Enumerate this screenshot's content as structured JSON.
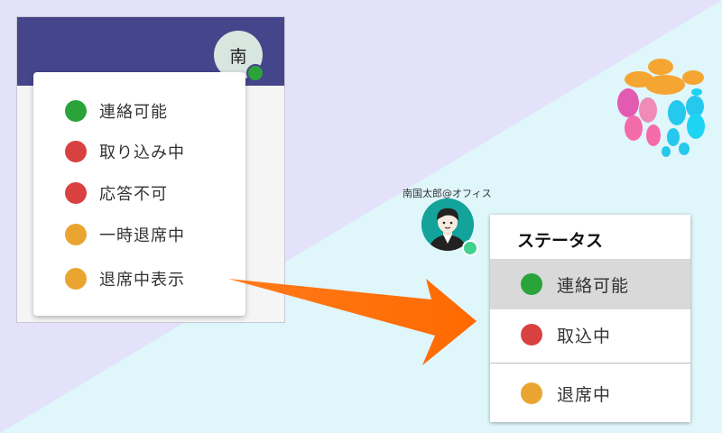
{
  "colors": {
    "available": "#2aa43a",
    "busy": "#d94141",
    "away": "#e9a530",
    "header": "#45458c"
  },
  "old_ui": {
    "avatar_initial": "南",
    "items": [
      {
        "label": "連絡可能",
        "status": "available"
      },
      {
        "label": "取り込み中",
        "status": "busy"
      },
      {
        "label": "応答不可",
        "status": "busy"
      },
      {
        "label": "一時退席中",
        "status": "away"
      },
      {
        "label": "退席中表示",
        "status": "away"
      }
    ]
  },
  "new_ui": {
    "user_label": "南国太郎@オフィス",
    "menu_title": "ステータス",
    "items": [
      {
        "label": "連絡可能",
        "status": "available",
        "selected": true
      },
      {
        "label": "取込中",
        "status": "busy",
        "selected": false
      },
      {
        "label": "退席中",
        "status": "away",
        "selected": false
      }
    ]
  }
}
